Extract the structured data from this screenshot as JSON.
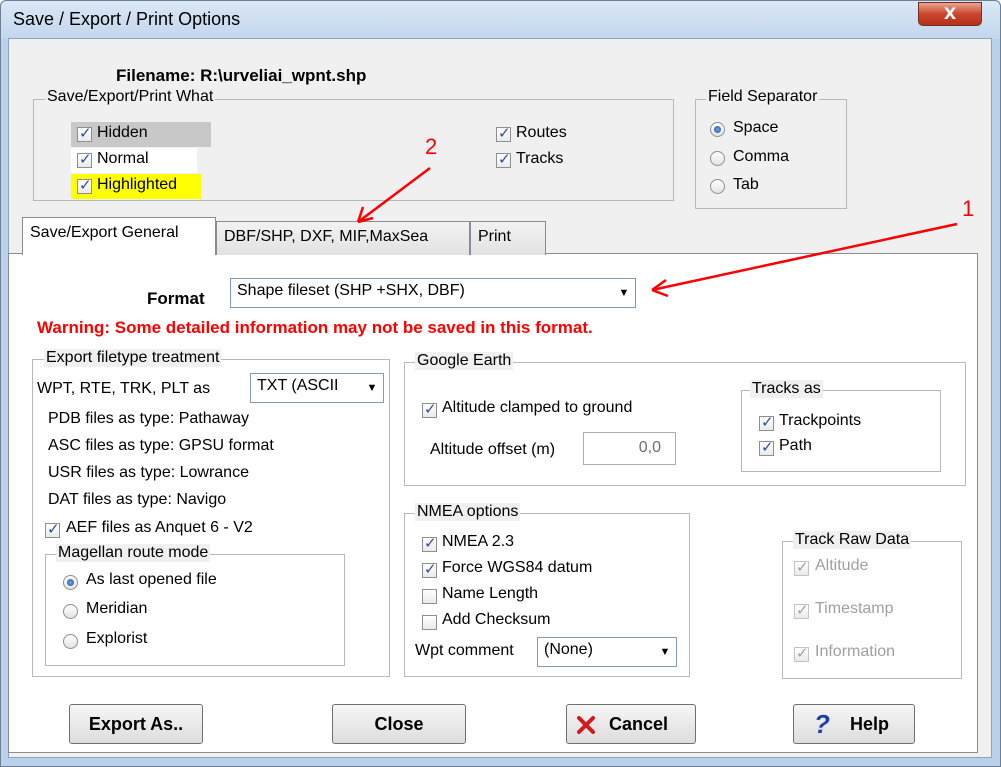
{
  "window": {
    "title": "Save / Export / Print Options",
    "close_glyph": "X"
  },
  "filename": {
    "label": "Filename:",
    "value": "R:\\urveliai_wpnt.shp"
  },
  "what_group": {
    "legend": "Save/Export/Print What",
    "hidden": "Hidden",
    "normal": "Normal",
    "highlighted": "Highlighted",
    "routes": "Routes",
    "tracks": "Tracks",
    "colors": {
      "hidden_bg": "#c8c8c8",
      "highlighted_bg": "#ffff00",
      "normal_bg": "#ffffff"
    }
  },
  "separator_group": {
    "legend": "Field Separator",
    "space": "Space",
    "comma": "Comma",
    "tab": "Tab",
    "selected": "Space"
  },
  "annotations": {
    "n1": "1",
    "n2": "2",
    "color": "#ff0000"
  },
  "tabs": [
    "Save/Export General",
    "DBF/SHP, DXF, MIF,MaxSea",
    "Print"
  ],
  "format": {
    "label": "Format",
    "value": "Shape fileset (SHP +SHX, DBF)"
  },
  "warning": {
    "text": "Warning: Some detailed information may not be saved in this format.",
    "color": "#ff0000"
  },
  "filetype_group": {
    "legend": "Export filetype treatment",
    "wpt_label": "WPT, RTE, TRK, PLT as",
    "wpt_value": "TXT (ASCII",
    "pdb": "PDB files as type: Pathaway",
    "asc": "ASC files as type: GPSU format",
    "usr": "USR files as type: Lowrance",
    "dat": "DAT files as type: Navigo",
    "aef": "AEF files as Anquet 6 - V2"
  },
  "magellan_group": {
    "legend": "Magellan route mode",
    "opt1": "As last opened file",
    "opt2": "Meridian",
    "opt3": "Explorist",
    "selected": "As last opened file"
  },
  "google_group": {
    "legend": "Google Earth",
    "altitude_clamped": "Altitude clamped to ground",
    "offset_label": "Altitude offset (m)",
    "offset_value": "0,0"
  },
  "tracks_as_group": {
    "legend": "Tracks as",
    "trackpoints": "Trackpoints",
    "path": "Path"
  },
  "nmea_group": {
    "legend": "NMEA options",
    "nmea23": "NMEA 2.3",
    "wgs84": "Force WGS84 datum",
    "name_length": "Name Length",
    "checksum": "Add Checksum",
    "wpt_comment_label": "Wpt comment",
    "wpt_comment_value": "(None)"
  },
  "raw_group": {
    "legend": "Track Raw Data",
    "altitude": "Altitude",
    "timestamp": "Timestamp",
    "information": "Information"
  },
  "buttons": {
    "export": "Export As..",
    "close": "Close",
    "cancel": "Cancel",
    "help": "Help"
  },
  "icons": {
    "cancel": "x-mark-icon",
    "help": "question-mark-icon",
    "dropdown": "chevron-down-icon"
  }
}
